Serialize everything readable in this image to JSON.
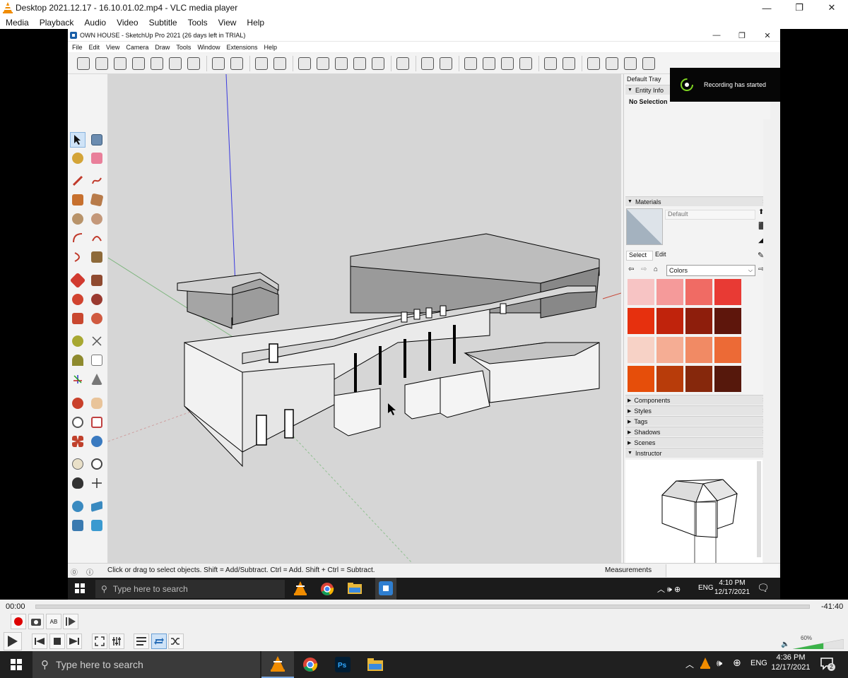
{
  "vlc": {
    "title": "Desktop 2021.12.17 - 16.10.01.02.mp4 - VLC media player",
    "menu": [
      "Media",
      "Playback",
      "Audio",
      "Video",
      "Subtitle",
      "Tools",
      "View",
      "Help"
    ],
    "time_elapsed": "00:00",
    "time_remaining": "-41:40",
    "volume_label": "60%",
    "volume": 0.6
  },
  "sketchup": {
    "title": "OWN HOUSE - SketchUp Pro 2021 (26 days left in TRIAL)",
    "menu": [
      "File",
      "Edit",
      "View",
      "Camera",
      "Draw",
      "Tools",
      "Window",
      "Extensions",
      "Help"
    ],
    "status_text": "Click or drag to select objects. Shift = Add/Subtract. Ctrl = Add. Shift + Ctrl = Subtract.",
    "measurements_label": "Measurements",
    "tray": {
      "title": "Default Tray",
      "entity_info": "Entity Info",
      "no_selection": "No Selection",
      "materials": "Materials",
      "material_name": "Default",
      "tab_select": "Select",
      "tab_edit": "Edit",
      "library": "Colors",
      "swatches": [
        "#f7c4c4",
        "#f59a9a",
        "#f06b64",
        "#e83a34",
        "#e6300e",
        "#c0230c",
        "#8e1e0c",
        "#5e160c",
        "#f7d2c6",
        "#f5ad94",
        "#f18a64",
        "#ec6a36",
        "#e64e0a",
        "#b83c0a",
        "#86280c",
        "#56180c"
      ],
      "panels": [
        "Components",
        "Styles",
        "Tags",
        "Shadows",
        "Scenes"
      ],
      "instructor": "Instructor"
    }
  },
  "toast": {
    "text": "Recording has started"
  },
  "inner_taskbar": {
    "search": "Type here to search",
    "lang": "ENG",
    "time": "4:10 PM",
    "date": "12/17/2021"
  },
  "taskbar": {
    "search": "Type here to search",
    "lang": "ENG",
    "time": "4:36 PM",
    "date": "12/17/2021",
    "notif_count": "2"
  }
}
